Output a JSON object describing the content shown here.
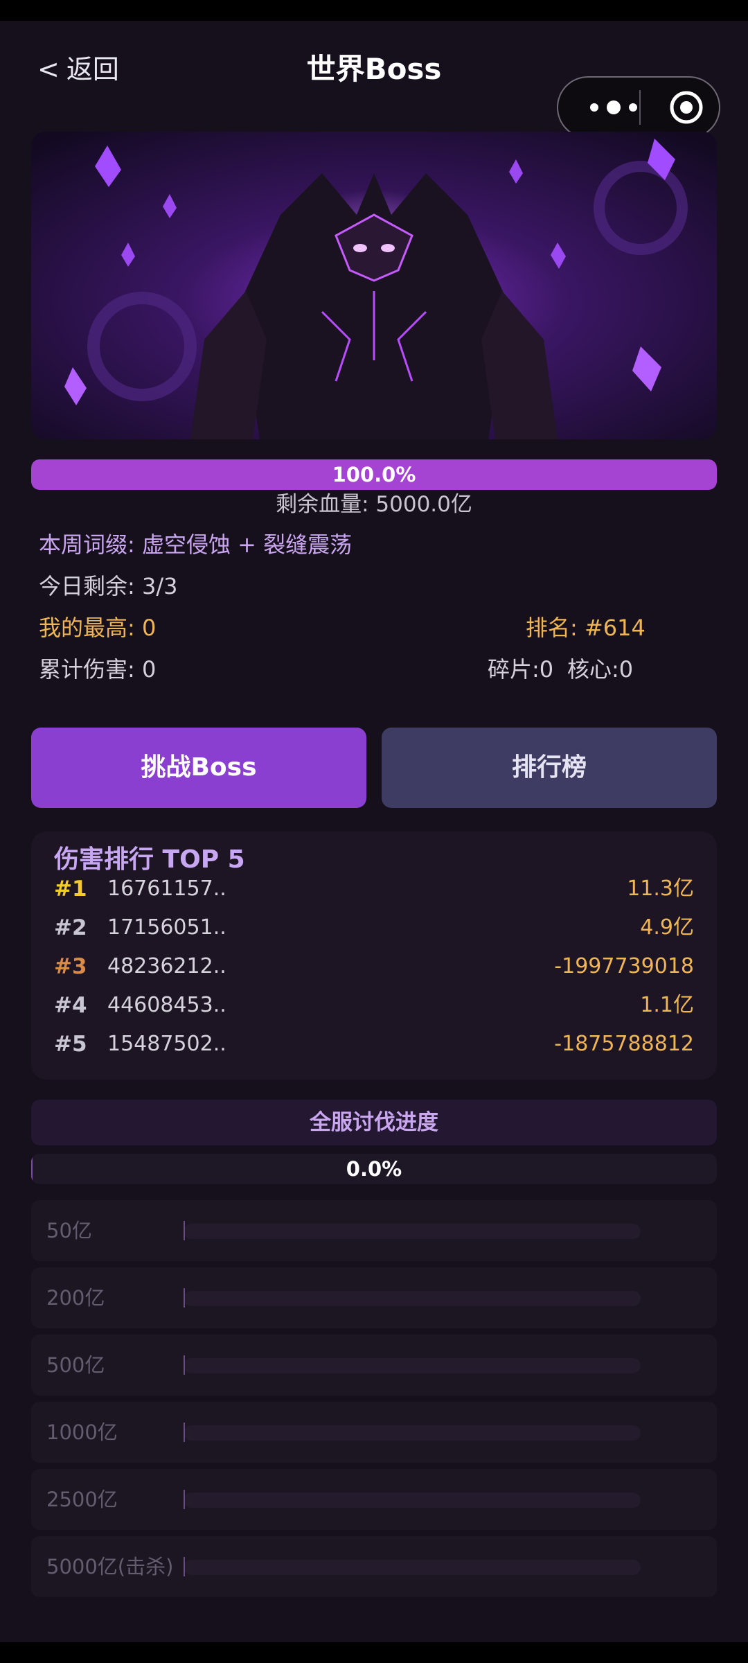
{
  "nav": {
    "back_icon": "<",
    "back_label": "返回",
    "title": "世界Boss"
  },
  "capsule": {
    "more_icon": "more-dots-icon",
    "close_icon": "target-circle-icon"
  },
  "boss": {
    "image_alt": "",
    "hp_percent_label": "100.0%",
    "hp_fraction": 1.0,
    "hp_remaining": "剩余血量: 5000.0亿"
  },
  "stats": {
    "affix": "本周词缀: 虚空侵蚀 + 裂缝震荡",
    "today_remaining": "今日剩余: 3/3",
    "my_best": "我的最高: 0",
    "my_rank": "排名: #614",
    "total_damage": "累计伤害: 0",
    "shards": "碎片:0",
    "cores": "核心:0"
  },
  "actions": {
    "challenge_label": "挑战Boss",
    "leaderboard_label": "排行榜"
  },
  "top5": {
    "title": "伤害排行 TOP 5",
    "rows": [
      {
        "rank": "#1",
        "player": "16761157..",
        "damage": "11.3亿",
        "color": "#f5cb2a"
      },
      {
        "rank": "#2",
        "player": "17156051..",
        "damage": "4.9亿",
        "color": "#c9c6d4"
      },
      {
        "rank": "#3",
        "player": "48236212..",
        "damage": "-1997739018",
        "color": "#d98b4a"
      },
      {
        "rank": "#4",
        "player": "44608453..",
        "damage": "1.1亿",
        "color": "#c9c6d4"
      },
      {
        "rank": "#5",
        "player": "15487502..",
        "damage": "-1875788812",
        "color": "#c9c6d4"
      }
    ]
  },
  "server": {
    "title": "全服讨伐进度",
    "progress_label": "0.0%",
    "progress_fraction": 0.0,
    "milestones": [
      {
        "label": "50亿",
        "fraction": 0
      },
      {
        "label": "200亿",
        "fraction": 0
      },
      {
        "label": "500亿",
        "fraction": 0
      },
      {
        "label": "1000亿",
        "fraction": 0
      },
      {
        "label": "2500亿",
        "fraction": 0
      },
      {
        "label": "5000亿(击杀)",
        "fraction": 0
      }
    ]
  },
  "colors": {
    "accent": "#a544d2",
    "gold": "#f0b655",
    "background": "#16101c"
  }
}
